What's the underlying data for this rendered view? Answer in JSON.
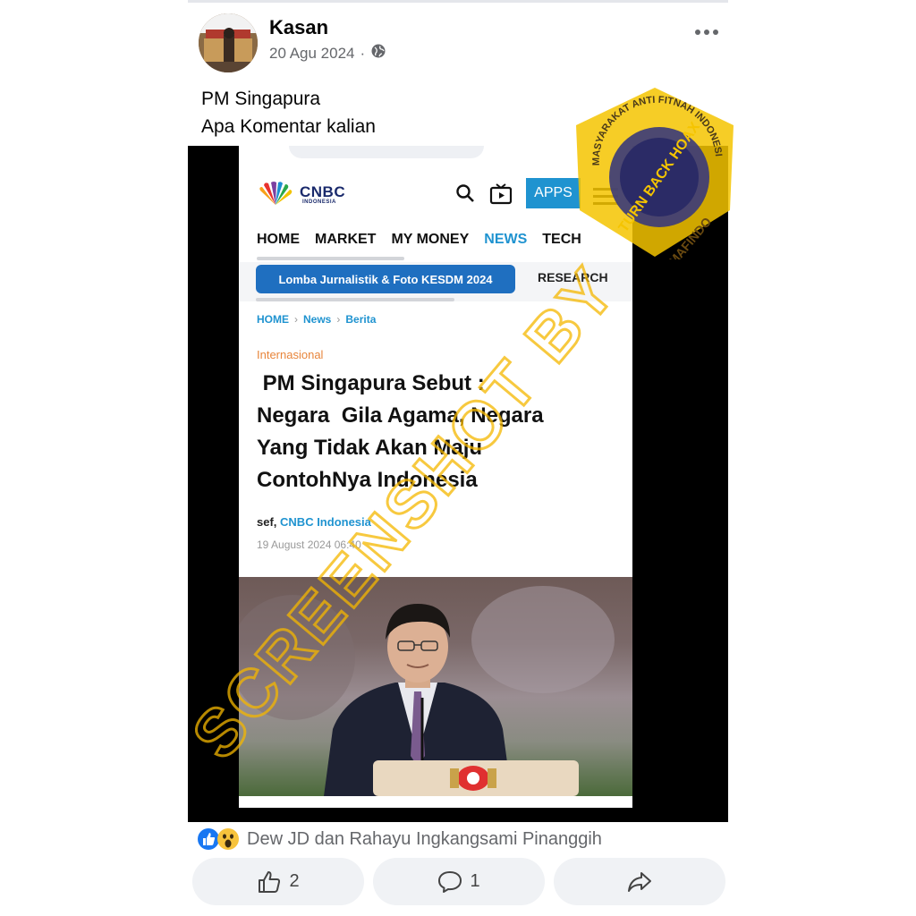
{
  "post": {
    "author": "Kasan",
    "date": "20 Agu 2024",
    "separator": "·",
    "text_line1": "PM Singapura",
    "text_line2": "Apa Komentar kalian"
  },
  "article": {
    "logo_text": "CNBC",
    "logo_sub": "INDONESIA",
    "apps_label": "APPS",
    "nav": [
      "HOME",
      "MARKET",
      "MY MONEY",
      "NEWS",
      "TECH"
    ],
    "promo": "Lomba Jurnalistik & Foto KESDM 2024",
    "research": "RESEARCH",
    "breadcrumb": [
      "HOME",
      "News",
      "Berita"
    ],
    "breadcrumb_sep": "›",
    "category": "Internasional",
    "headline_lines": [
      " PM Singapura Sebut :",
      "Negara  Gila Agama, Negara",
      "Yang Tidak Akan Maju",
      "ContohNya Indonesia"
    ],
    "byline_author": "sef,",
    "byline_source": "CNBC Indonesia",
    "date": "19 August 2024 06:40"
  },
  "watermark": {
    "text": "SCREENSHOT BY",
    "stamp_top": "MASYARAKAT ANTI FITNAH INDONESIA",
    "stamp_center": "TURN BACK HOAX",
    "stamp_bottom": "MAFINDO",
    "color": "#f5b700"
  },
  "reactions": {
    "names": "Dew JD dan Rahayu Ingkangsami Pinanggih",
    "like_count": "2",
    "comment_count": "1"
  },
  "colors": {
    "accent": "#1f93d0",
    "like_blue": "#1877f2"
  },
  "icons": [
    "globe-icon",
    "more-icon",
    "search-icon",
    "tv-icon",
    "menu-icon",
    "like-icon",
    "wow-icon",
    "thumb-up-icon",
    "comment-icon",
    "share-icon"
  ]
}
